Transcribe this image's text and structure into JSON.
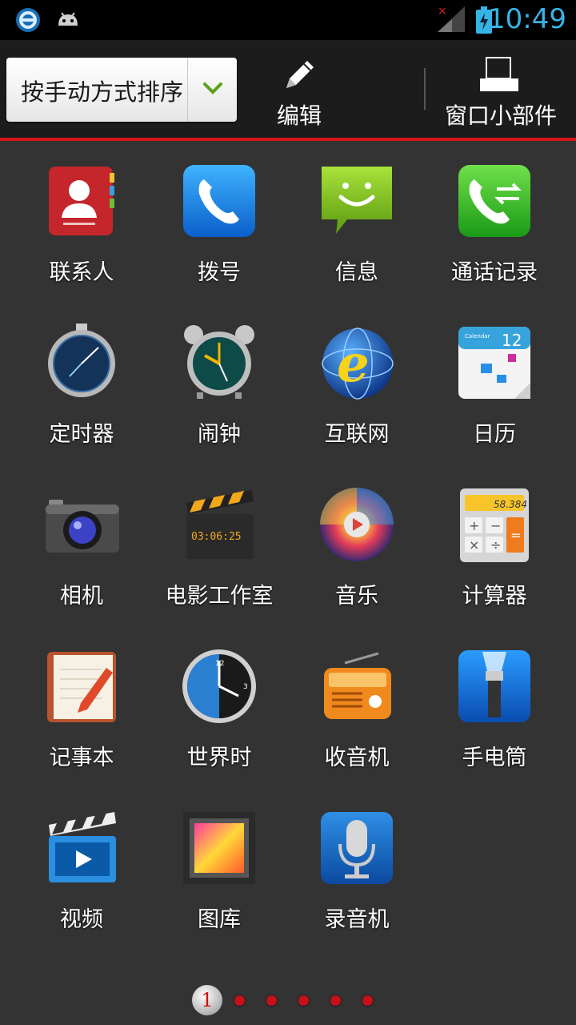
{
  "status_bar": {
    "time": "10:49",
    "icons": [
      "browser-notification-icon",
      "android-debug-icon",
      "signal-icon",
      "battery-charging-icon"
    ]
  },
  "toolbar": {
    "sort_label": "按手动方式排序",
    "edit_label": "编辑",
    "widgets_label": "窗口小部件",
    "accent_color": "#d8141b"
  },
  "apps": [
    {
      "label": "联系人",
      "icon": "contacts-icon"
    },
    {
      "label": "拨号",
      "icon": "phone-icon"
    },
    {
      "label": "信息",
      "icon": "messaging-icon"
    },
    {
      "label": "通话记录",
      "icon": "call-log-icon"
    },
    {
      "label": "定时器",
      "icon": "stopwatch-icon"
    },
    {
      "label": "闹钟",
      "icon": "alarm-clock-icon"
    },
    {
      "label": "互联网",
      "icon": "browser-icon"
    },
    {
      "label": "日历",
      "icon": "calendar-icon"
    },
    {
      "label": "相机",
      "icon": "camera-icon"
    },
    {
      "label": "电影工作室",
      "icon": "movie-studio-icon"
    },
    {
      "label": "音乐",
      "icon": "music-icon"
    },
    {
      "label": "计算器",
      "icon": "calculator-icon"
    },
    {
      "label": "记事本",
      "icon": "notepad-icon"
    },
    {
      "label": "世界时",
      "icon": "world-clock-icon"
    },
    {
      "label": "收音机",
      "icon": "radio-icon"
    },
    {
      "label": "手电筒",
      "icon": "flashlight-icon"
    },
    {
      "label": "视频",
      "icon": "video-icon"
    },
    {
      "label": "图库",
      "icon": "gallery-icon"
    },
    {
      "label": "录音机",
      "icon": "voice-recorder-icon"
    }
  ],
  "icon_text": {
    "calendar_day": "12",
    "calendar_header": "Calendar",
    "calculator_display": "58.384",
    "movie_timecode": "03:06:25"
  },
  "pager": {
    "current_page": "1",
    "total_pages": 6
  }
}
